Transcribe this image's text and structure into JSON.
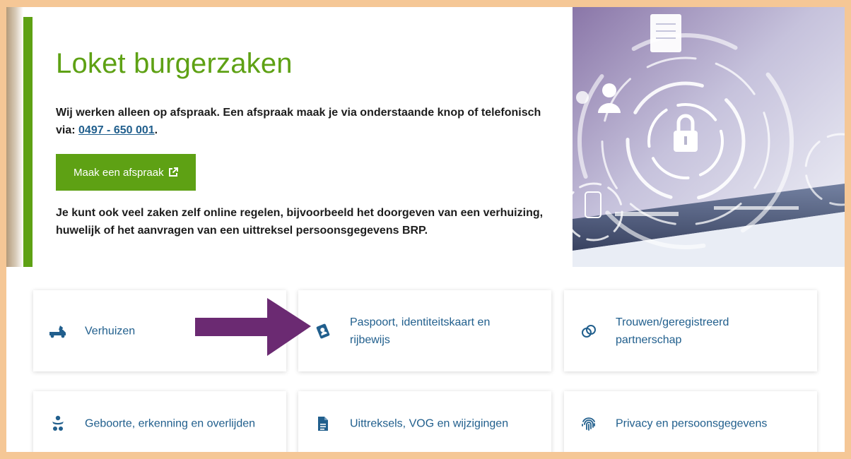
{
  "hero": {
    "title": "Loket burgerzaken",
    "intro_text": "Wij werken alleen op afspraak. Een afspraak maak je via onderstaande knop of telefonisch via: ",
    "phone": "0497 - 650 001",
    "intro_end": ".",
    "cta_label": "Maak een afspraak",
    "body_text": "Je kunt ook veel zaken zelf online regelen, bijvoorbeeld het doorgeven van een verhuizing, huwelijk of het aanvragen van een uittreksel persoonsgegevens BRP."
  },
  "tiles": [
    {
      "label": "Verhuizen",
      "icon": "moving-truck-icon"
    },
    {
      "label": "Paspoort, identiteitskaart en rijbewijs",
      "icon": "passport-icon"
    },
    {
      "label": "Trouwen/geregistreerd partnerschap",
      "icon": "rings-icon"
    },
    {
      "label": "Geboorte, erkenning en overlijden",
      "icon": "baby-icon"
    },
    {
      "label": "Uittreksels, VOG en wijzigingen",
      "icon": "document-icon"
    },
    {
      "label": "Privacy en persoonsgegevens",
      "icon": "fingerprint-icon"
    }
  ],
  "annotation": {
    "icon": "arrow-icon",
    "color": "#6b2a72"
  },
  "colors": {
    "accent": "#5ea114",
    "link": "#215f8d",
    "frame": "#f5c796"
  }
}
